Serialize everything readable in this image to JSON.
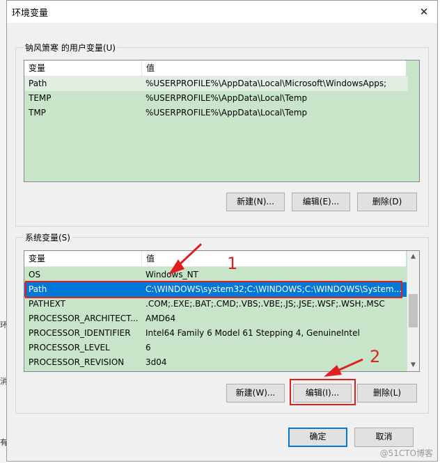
{
  "window": {
    "title": "环境变量",
    "close_symbol": "✕"
  },
  "background_fragments": [
    "环",
    "消",
    "有"
  ],
  "user_vars": {
    "group_label": "钠风箫寒 的用户变量(U)",
    "columns": [
      "变量",
      "值"
    ],
    "rows": [
      {
        "name": "Path",
        "value": "%USERPROFILE%\\AppData\\Local\\Microsoft\\WindowsApps;"
      },
      {
        "name": "TEMP",
        "value": "%USERPROFILE%\\AppData\\Local\\Temp"
      },
      {
        "name": "TMP",
        "value": "%USERPROFILE%\\AppData\\Local\\Temp"
      }
    ],
    "buttons": {
      "new": "新建(N)...",
      "edit": "编辑(E)...",
      "delete": "删除(D)"
    }
  },
  "system_vars": {
    "group_label": "系统变量(S)",
    "columns": [
      "变量",
      "值"
    ],
    "rows": [
      {
        "name": "OS",
        "value": "Windows_NT"
      },
      {
        "name": "Path",
        "value": "C:\\WINDOWS\\system32;C:\\WINDOWS;C:\\WINDOWS\\System..."
      },
      {
        "name": "PATHEXT",
        "value": ".COM;.EXE;.BAT;.CMD;.VBS;.VBE;.JS;.JSE;.WSF;.WSH;.MSC"
      },
      {
        "name": "PROCESSOR_ARCHITECT...",
        "value": "AMD64"
      },
      {
        "name": "PROCESSOR_IDENTIFIER",
        "value": "Intel64 Family 6 Model 61 Stepping 4, GenuineIntel"
      },
      {
        "name": "PROCESSOR_LEVEL",
        "value": "6"
      },
      {
        "name": "PROCESSOR_REVISION",
        "value": "3d04"
      }
    ],
    "selected_row": "Path",
    "buttons": {
      "new": "新建(W)...",
      "edit": "编辑(I)...",
      "delete": "删除(L)"
    }
  },
  "footer": {
    "ok": "确定",
    "cancel": "取消"
  },
  "annotations": {
    "step1": "1",
    "step2": "2",
    "color": "#e02020"
  },
  "watermark": "@51CTO博客",
  "colors": {
    "list_bg": "#c9e5c9",
    "selection": "#0078d7",
    "dialog_bg": "#f0f0f0"
  }
}
